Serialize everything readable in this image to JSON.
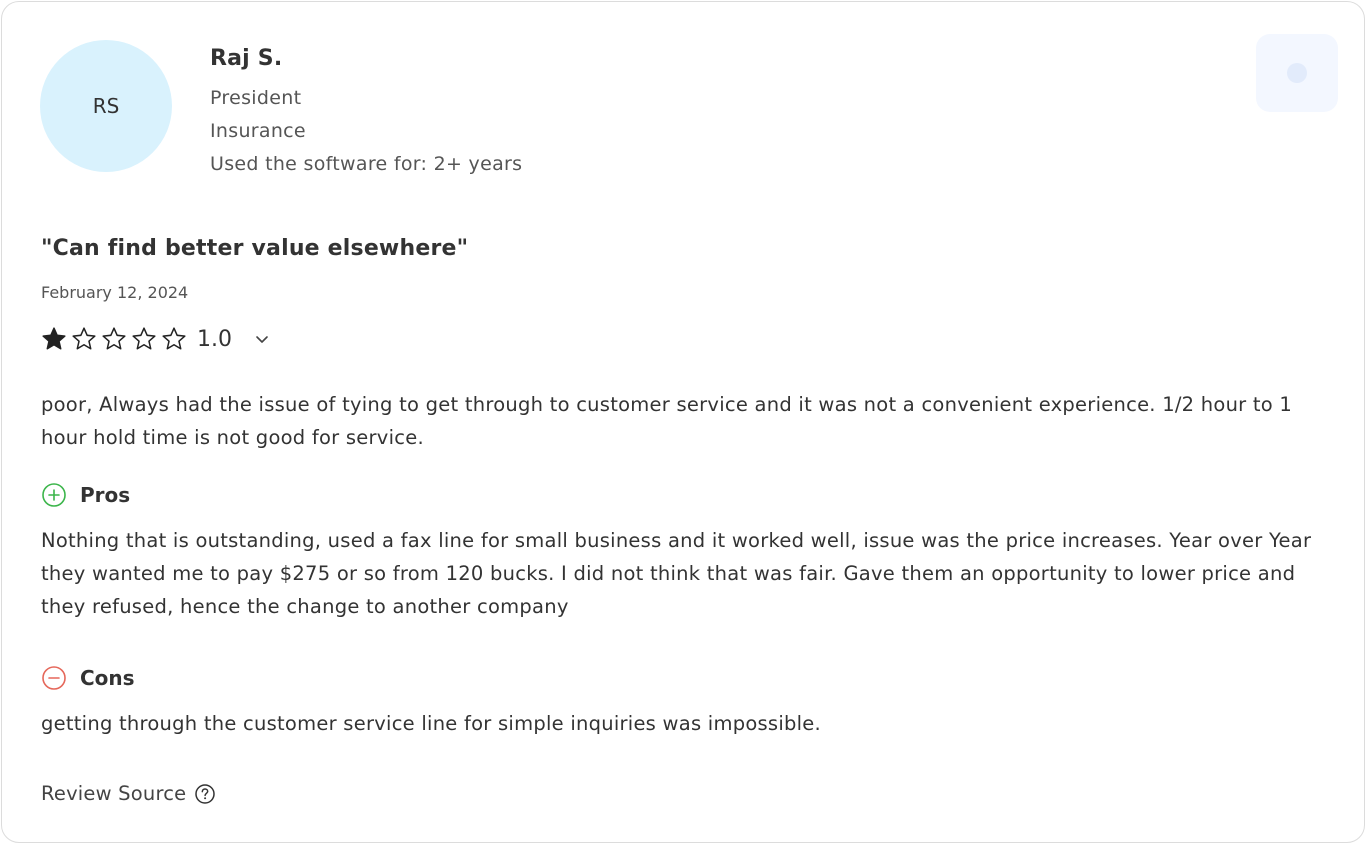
{
  "reviewer": {
    "initials": "RS",
    "name": "Raj S.",
    "role": "President",
    "industry": "Insurance",
    "usage": "Used the software for: 2+ years"
  },
  "review": {
    "title": "\"Can find better value elsewhere\"",
    "date": "February 12, 2024",
    "rating": 1.0,
    "rating_label": "1.0",
    "rating_max": 5,
    "summary": "poor, Always had the issue of tying to get through to customer service and it was not a convenient experience. 1/2 hour to 1 hour hold time is not good for service.",
    "pros_label": "Pros",
    "pros": "Nothing that is outstanding, used a fax line for small business and it worked well, issue was the price increases. Year over Year they wanted me to pay $275 or so from 120 bucks. I did not think that was fair. Gave them an opportunity to lower price and they refused, hence the change to another company",
    "cons_label": "Cons",
    "cons": "getting through the customer service line for simple inquiries was impossible.",
    "source_label": "Review Source"
  },
  "colors": {
    "avatar_bg": "#d9f2fd",
    "pros_accent": "#3bb54a",
    "cons_accent": "#e5675a",
    "star_fill": "#222222"
  }
}
